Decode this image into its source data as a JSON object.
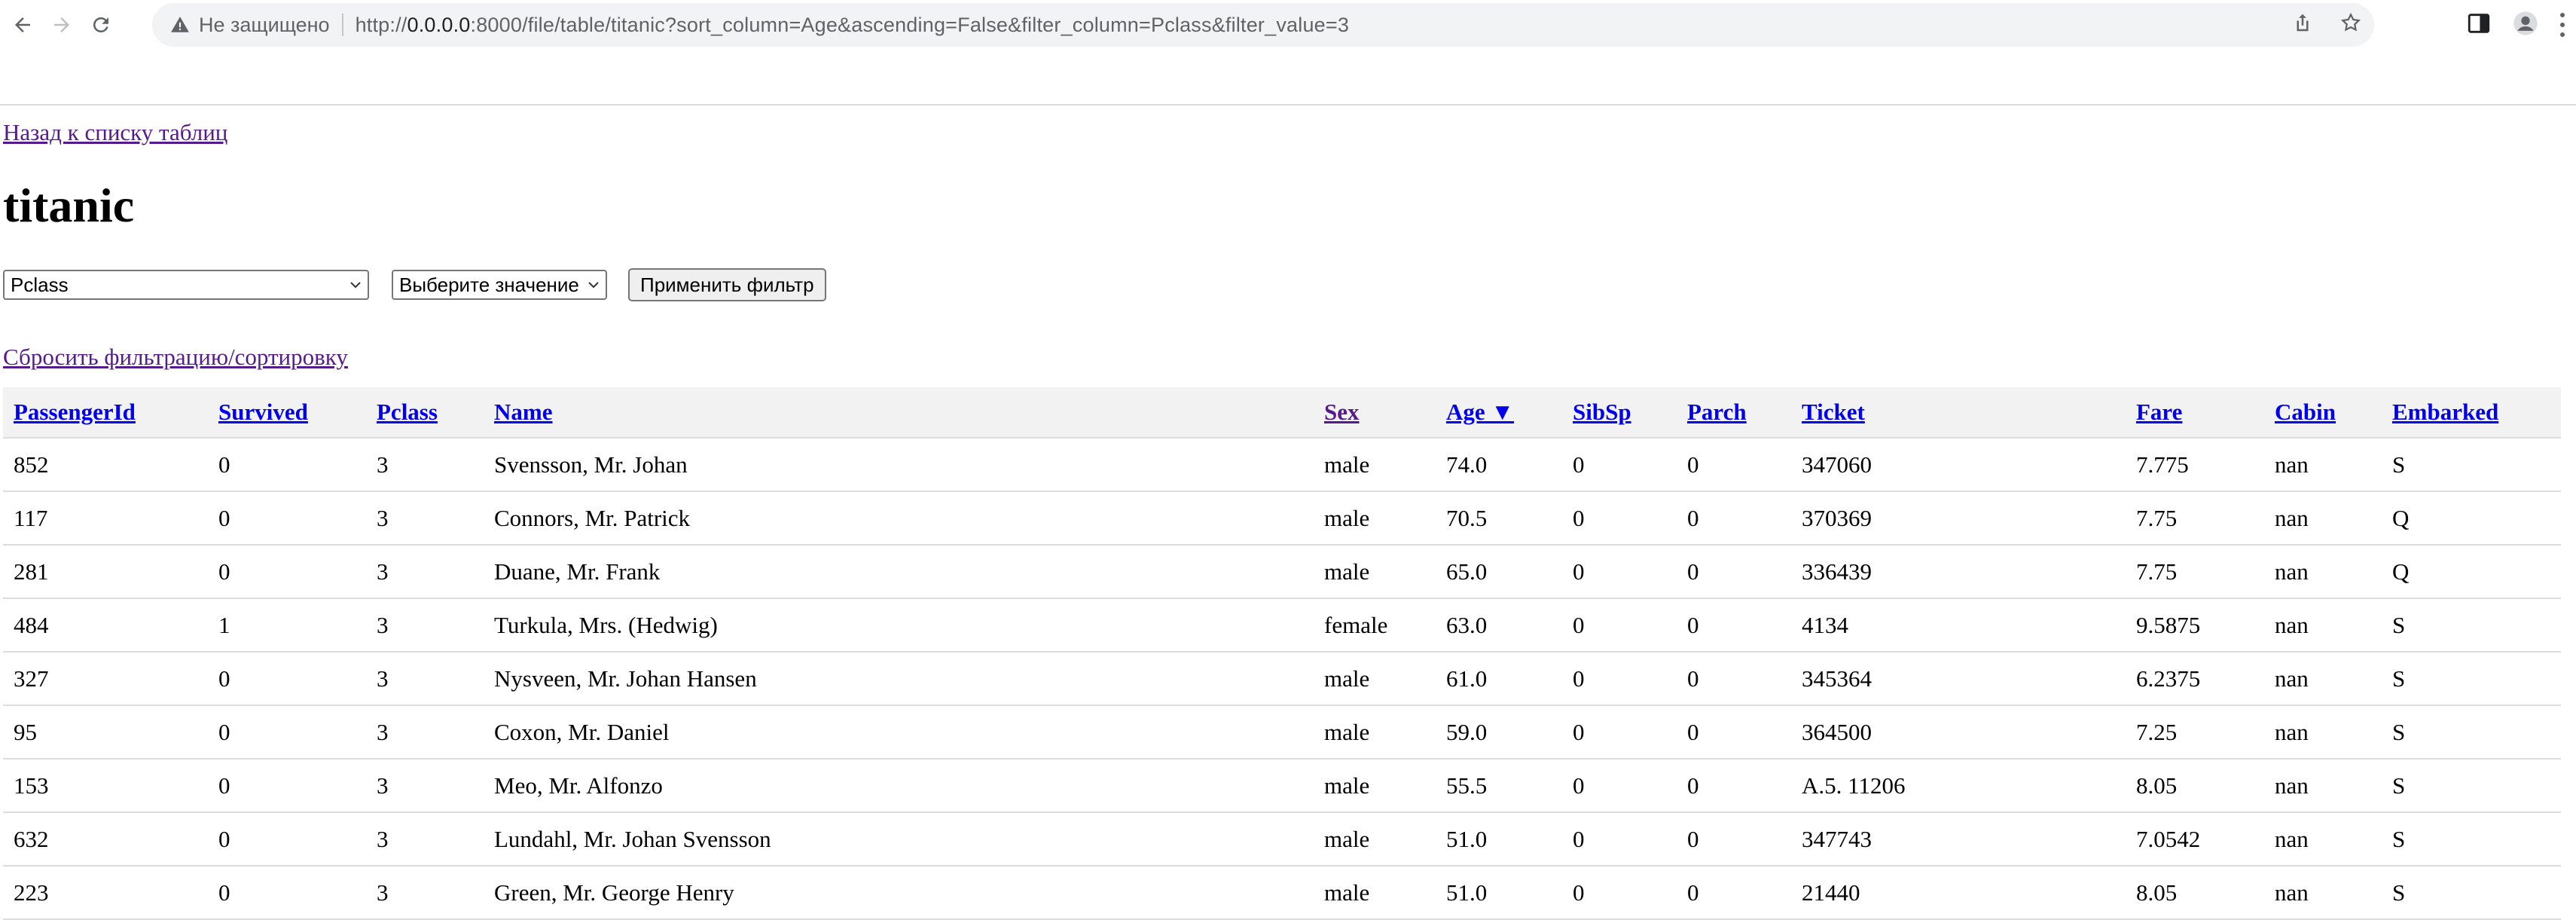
{
  "browser": {
    "not_secure": "Не защищено",
    "url_prefix": "http://",
    "url_host": "0.0.0.0",
    "url_rest": ":8000/file/table/titanic?sort_column=Age&ascending=False&filter_column=Pclass&filter_value=3"
  },
  "page": {
    "back_link": "Назад к списку таблиц",
    "title": "titanic",
    "filter_column_value": "Pclass",
    "filter_value_placeholder": "Выберите значение",
    "apply_button": "Применить фильтр",
    "reset_link": "Сбросить фильтрацию/сортировку"
  },
  "table": {
    "columns": [
      "PassengerId",
      "Survived",
      "Pclass",
      "Name",
      "Sex",
      "Age ▼",
      "SibSp",
      "Parch",
      "Ticket",
      "Fare",
      "Cabin",
      "Embarked"
    ],
    "rows": [
      [
        "852",
        "0",
        "3",
        "Svensson, Mr. Johan",
        "male",
        "74.0",
        "0",
        "0",
        "347060",
        "7.775",
        "nan",
        "S"
      ],
      [
        "117",
        "0",
        "3",
        "Connors, Mr. Patrick",
        "male",
        "70.5",
        "0",
        "0",
        "370369",
        "7.75",
        "nan",
        "Q"
      ],
      [
        "281",
        "0",
        "3",
        "Duane, Mr. Frank",
        "male",
        "65.0",
        "0",
        "0",
        "336439",
        "7.75",
        "nan",
        "Q"
      ],
      [
        "484",
        "1",
        "3",
        "Turkula, Mrs. (Hedwig)",
        "female",
        "63.0",
        "0",
        "0",
        "4134",
        "9.5875",
        "nan",
        "S"
      ],
      [
        "327",
        "0",
        "3",
        "Nysveen, Mr. Johan Hansen",
        "male",
        "61.0",
        "0",
        "0",
        "345364",
        "6.2375",
        "nan",
        "S"
      ],
      [
        "95",
        "0",
        "3",
        "Coxon, Mr. Daniel",
        "male",
        "59.0",
        "0",
        "0",
        "364500",
        "7.25",
        "nan",
        "S"
      ],
      [
        "153",
        "0",
        "3",
        "Meo, Mr. Alfonzo",
        "male",
        "55.5",
        "0",
        "0",
        "A.5. 11206",
        "8.05",
        "nan",
        "S"
      ],
      [
        "632",
        "0",
        "3",
        "Lundahl, Mr. Johan Svensson",
        "male",
        "51.0",
        "0",
        "0",
        "347743",
        "7.0542",
        "nan",
        "S"
      ],
      [
        "223",
        "0",
        "3",
        "Green, Mr. George Henry",
        "male",
        "51.0",
        "0",
        "0",
        "21440",
        "8.05",
        "nan",
        "S"
      ]
    ]
  }
}
